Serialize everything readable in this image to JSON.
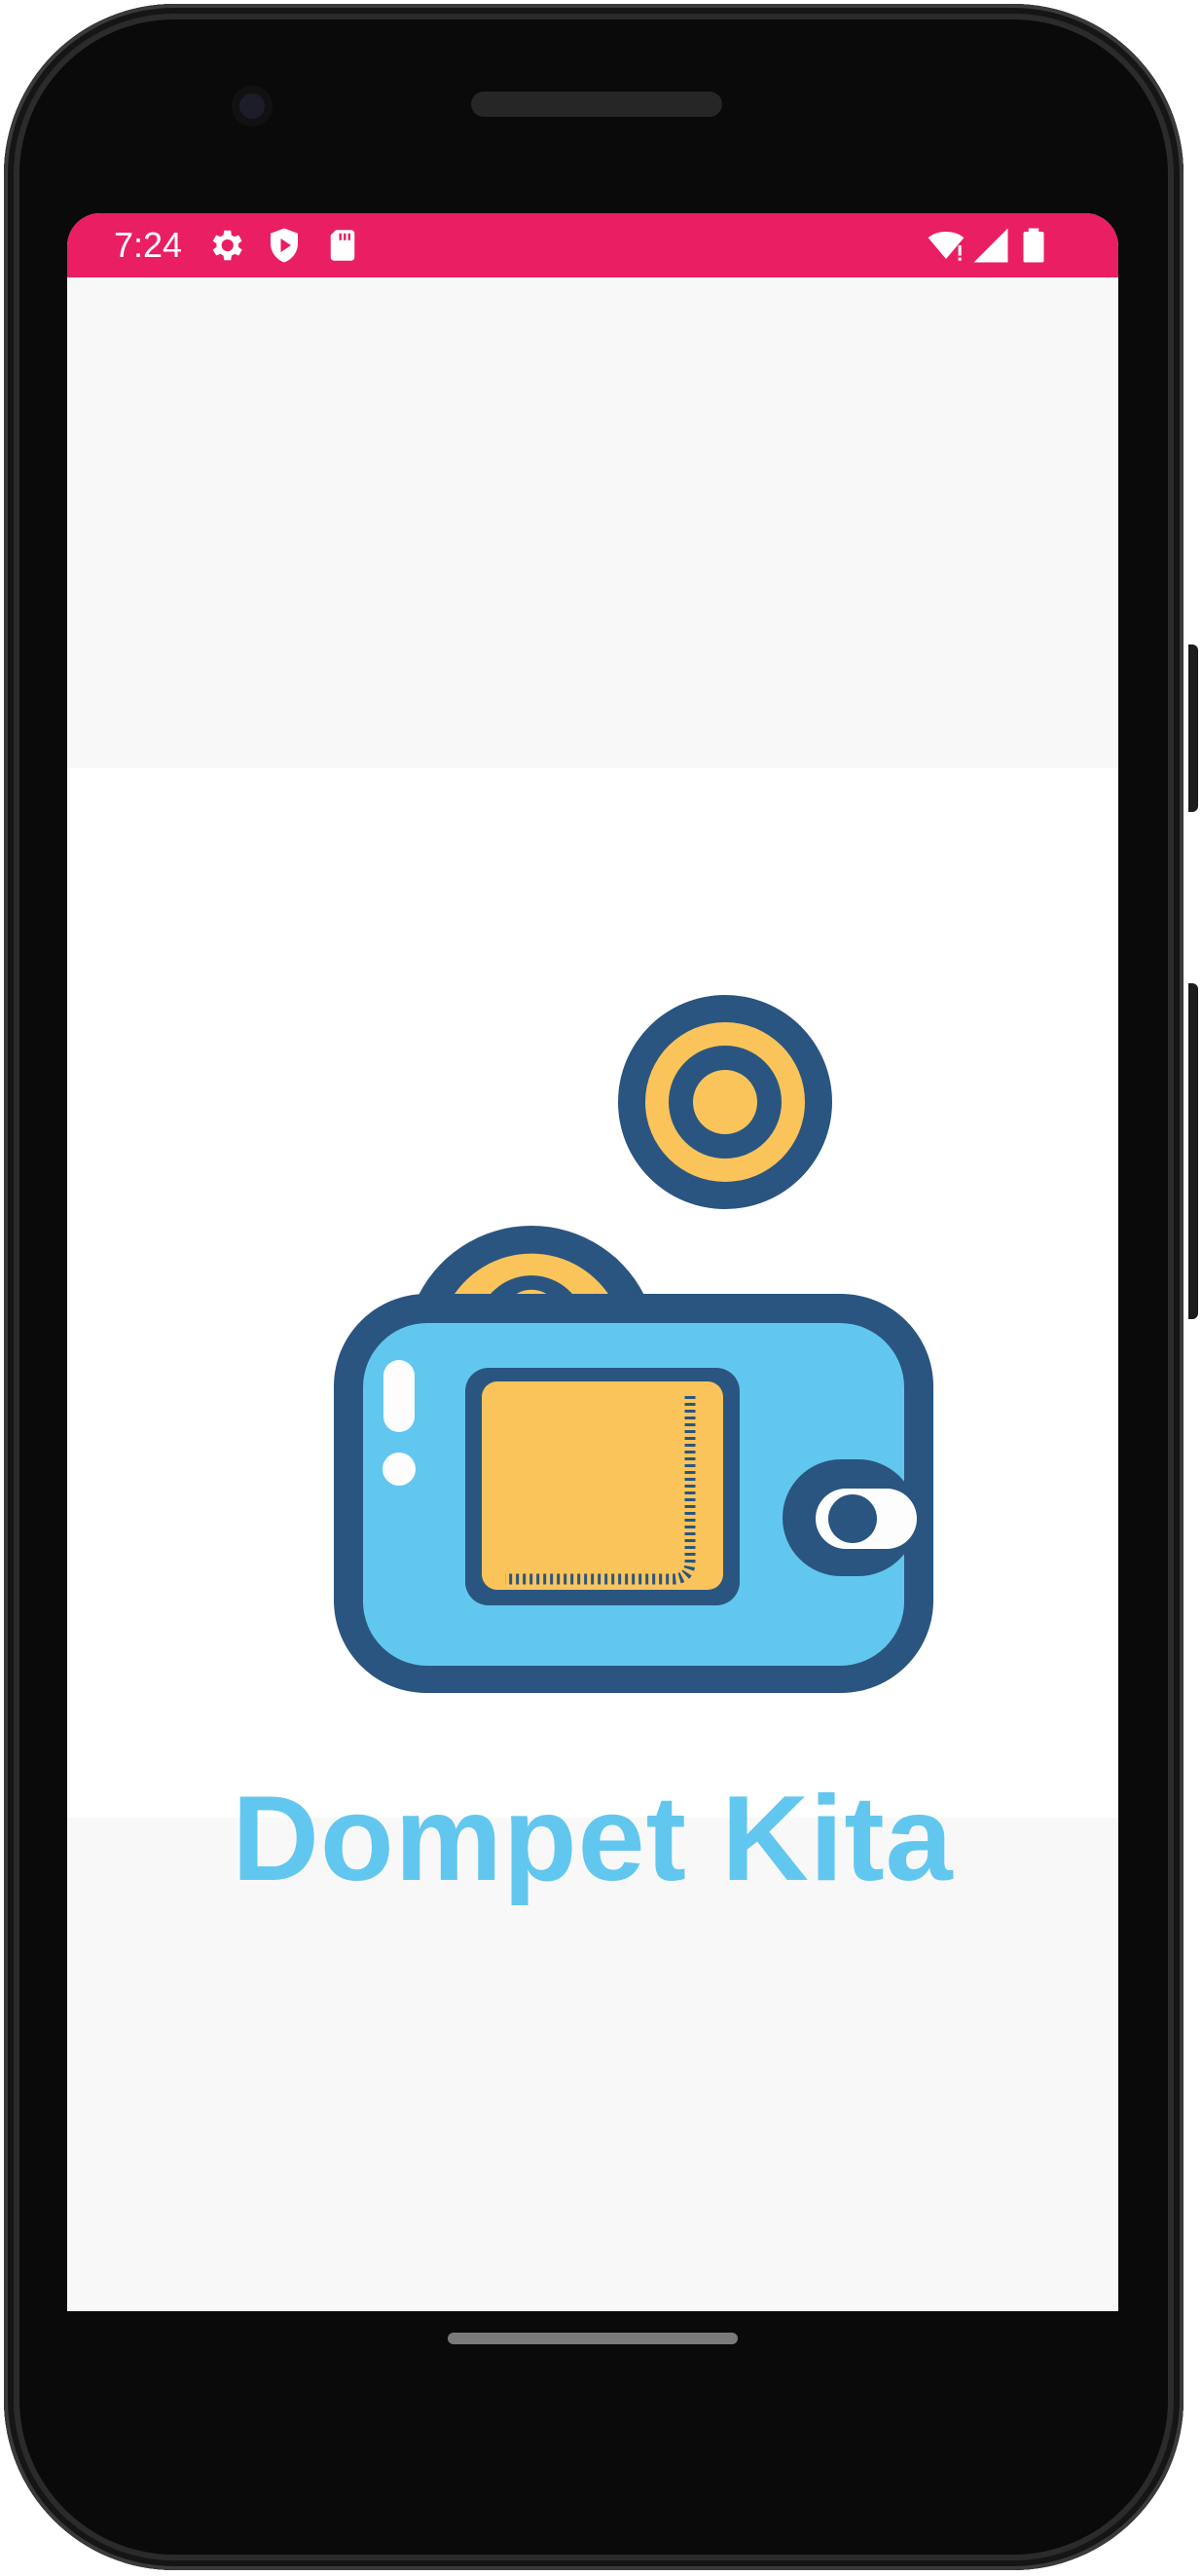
{
  "status_bar": {
    "time": "7:24",
    "color": "#e91e63",
    "left_icons": [
      "settings-icon",
      "play-protect-icon",
      "sd-card-icon"
    ],
    "right_icons": [
      "wifi-icon",
      "signal-icon",
      "battery-icon"
    ]
  },
  "splash": {
    "logo_icon": "wallet-icon",
    "title": "Dompet Kita",
    "title_color": "#62c7ee"
  }
}
